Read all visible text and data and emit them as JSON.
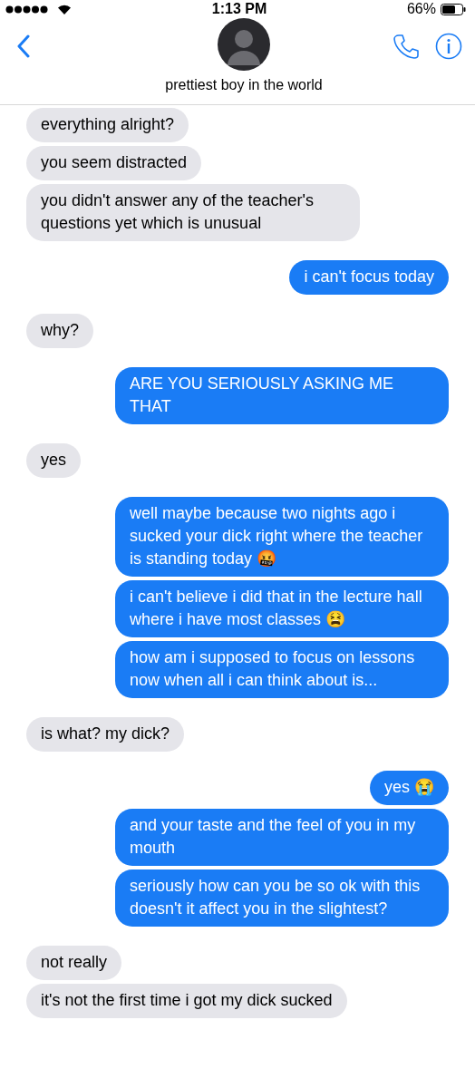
{
  "status_bar": {
    "time": "1:13 PM",
    "battery": "66%"
  },
  "header": {
    "contact_name": "prettiest boy in the world"
  },
  "groups": [
    {
      "kind": "incoming",
      "messages": [
        "everything alright?",
        "you seem distracted",
        "you didn't answer any of the teacher's questions yet which is unusual"
      ]
    },
    {
      "kind": "outgoing",
      "messages": [
        "i can't focus today"
      ]
    },
    {
      "kind": "incoming",
      "messages": [
        "why?"
      ]
    },
    {
      "kind": "outgoing",
      "messages": [
        "ARE YOU SERIOUSLY ASKING ME THAT"
      ]
    },
    {
      "kind": "incoming",
      "messages": [
        "yes"
      ]
    },
    {
      "kind": "outgoing",
      "messages": [
        "well maybe because two nights ago i sucked your dick right where the teacher is standing today 🤬",
        "i can't believe i did that in the lecture hall where i have most classes 😫",
        "how am i supposed to focus on lessons now when all i can think about is..."
      ]
    },
    {
      "kind": "incoming",
      "messages": [
        "is what? my dick?"
      ]
    },
    {
      "kind": "outgoing",
      "messages": [
        "yes 😭",
        "and your taste and the feel of you in my mouth",
        "seriously how can you be so ok with this doesn't it affect you in the slightest?"
      ]
    },
    {
      "kind": "incoming",
      "messages": [
        "not really",
        "it's not the first time i got my dick sucked"
      ]
    }
  ]
}
